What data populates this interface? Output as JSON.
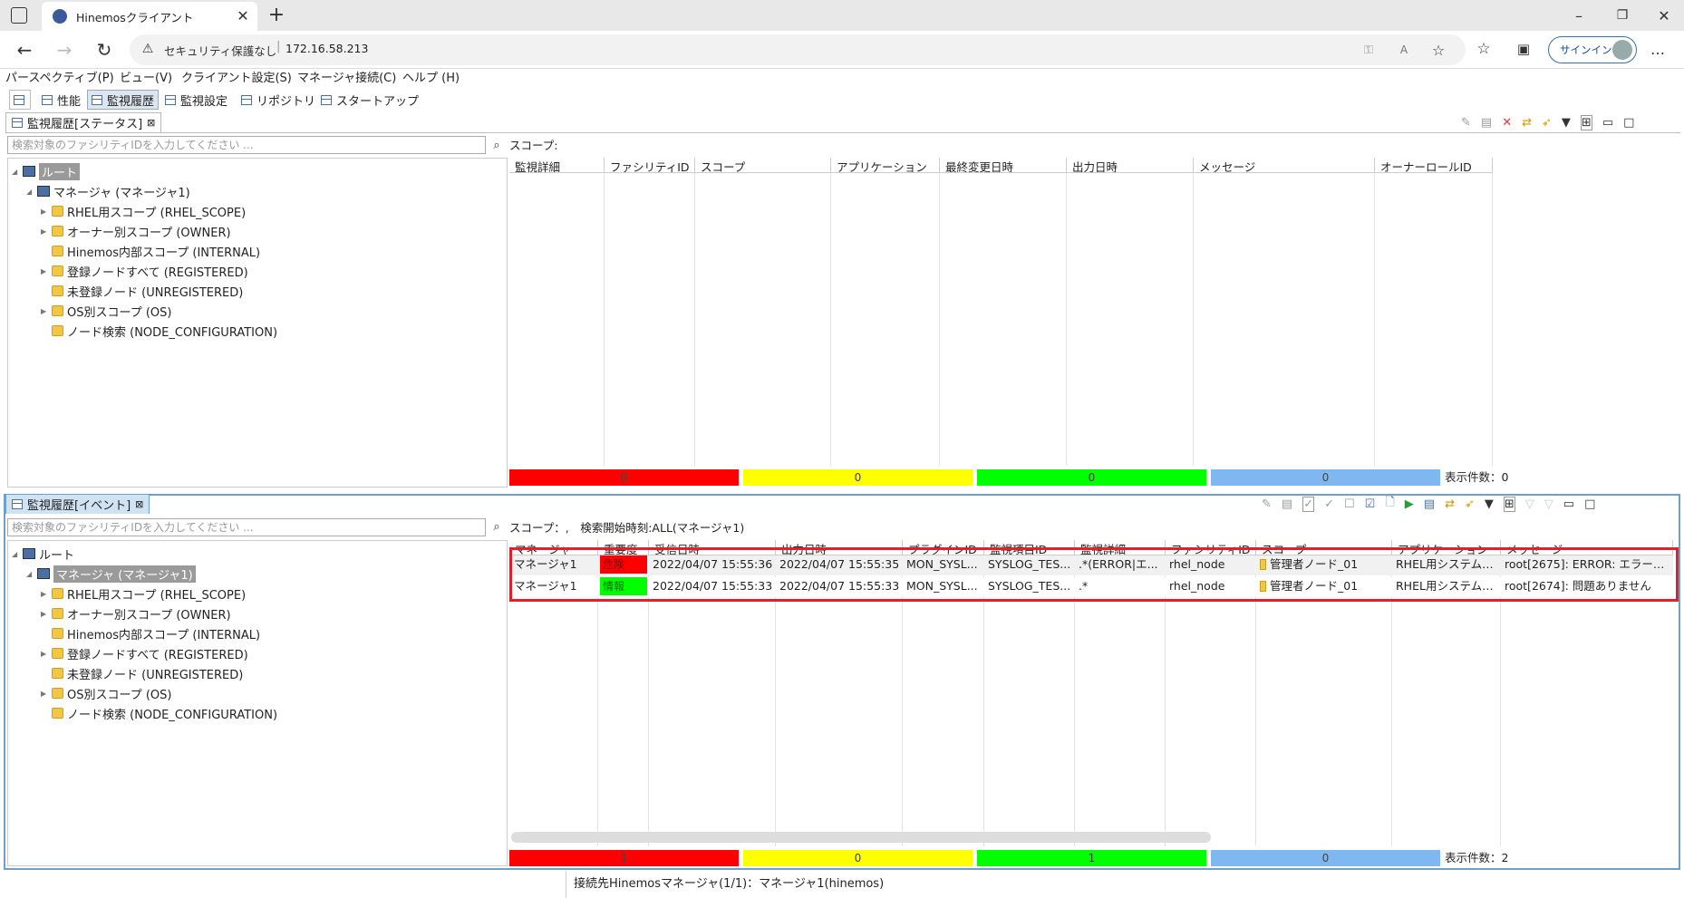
{
  "browser": {
    "tab_title": "Hinemosクライアント",
    "security_label": "セキュリティ保護なし",
    "address": "172.16.58.213",
    "signin_label": "サインイン"
  },
  "menu": [
    "パースペクティブ(P)",
    "ビュー(V)",
    "クライアント設定(S)",
    "マネージャ接続(C)",
    "ヘルプ (H)"
  ],
  "perspectives": [
    {
      "label": "性能",
      "active": false
    },
    {
      "label": "監視履歴",
      "active": true
    },
    {
      "label": "監視設定",
      "active": false
    },
    {
      "label": "リポジトリ",
      "active": false
    },
    {
      "label": "スタートアップ",
      "active": false
    }
  ],
  "status_view": {
    "tab_label": "監視履歴[ステータス]",
    "search_placeholder": "検索対象のファシリティIDを入力してください ...",
    "scope_label": "スコープ:",
    "tree": {
      "root": "ルート",
      "manager": "マネージャ (マネージャ1)",
      "scopes": [
        "RHEL用スコープ (RHEL_SCOPE)",
        "オーナー別スコープ (OWNER)",
        "Hinemos内部スコープ (INTERNAL)",
        "登録ノードすべて (REGISTERED)",
        "未登録ノード (UNREGISTERED)",
        "OS別スコープ (OS)",
        "ノード検索 (NODE_CONFIGURATION)"
      ]
    },
    "columns": [
      "監視詳細",
      "ファシリティID",
      "スコープ",
      "アプリケーション",
      "最終変更日時",
      "出力日時",
      "メッセージ",
      "オーナーロールID"
    ],
    "counts": {
      "critical": "0",
      "warning": "0",
      "info": "0",
      "unknown": "0"
    },
    "total_label": "表示件数：0"
  },
  "event_view": {
    "tab_label": "監視履歴[イベント]",
    "search_placeholder": "検索対象のファシリティIDを入力してください ...",
    "scope_label": "スコープ：,　検索開始時刻:ALL(マネージャ1)",
    "tree": {
      "root": "ルート",
      "manager": "マネージャ (マネージャ1)",
      "scopes": [
        "RHEL用スコープ (RHEL_SCOPE)",
        "オーナー別スコープ (OWNER)",
        "Hinemos内部スコープ (INTERNAL)",
        "登録ノードすべて (REGISTERED)",
        "未登録ノード (UNREGISTERED)",
        "OS別スコープ (OS)",
        "ノード検索 (NODE_CONFIGURATION)"
      ]
    },
    "columns": [
      "マネージャ",
      "重要度",
      "受信日時",
      "出力日時",
      "プラグインID",
      "監視項目ID",
      "監視詳細",
      "ファシリティID",
      "スコープ",
      "アプリケーション",
      "メッセージ"
    ],
    "rows": [
      {
        "manager": "マネージャ1",
        "severity": "危険",
        "severity_color": "#ff0000",
        "received": "2022/04/07 15:55:36",
        "output": "2022/04/07 15:55:35",
        "plugin": "MON_SYSL...",
        "monitor": "SYSLOG_TES...",
        "detail": ".*(ERROR|エ...",
        "facility": "rhel_node",
        "scope": "管理者ノード_01",
        "application": "RHEL用システムロ...",
        "message": "root[2675]: ERROR: エラーが..."
      },
      {
        "manager": "マネージャ1",
        "severity": "情報",
        "severity_color": "#00ff00",
        "received": "2022/04/07 15:55:33",
        "output": "2022/04/07 15:55:33",
        "plugin": "MON_SYSL...",
        "monitor": "SYSLOG_TES...",
        "detail": ".*",
        "facility": "rhel_node",
        "scope": "管理者ノード_01",
        "application": "RHEL用システムロ...",
        "message": "root[2674]: 問題ありません"
      }
    ],
    "counts": {
      "critical": "1",
      "warning": "0",
      "info": "1",
      "unknown": "0"
    },
    "total_label": "表示件数：2"
  },
  "status_line": "接続先Hinemosマネージャ(1/1)：マネージャ1(hinemos)",
  "colors": {
    "critical": "#ff0000",
    "warning": "#ffff00",
    "info": "#00ff00",
    "unknown": "#7fb8f0",
    "highlight": "#e0202a"
  }
}
